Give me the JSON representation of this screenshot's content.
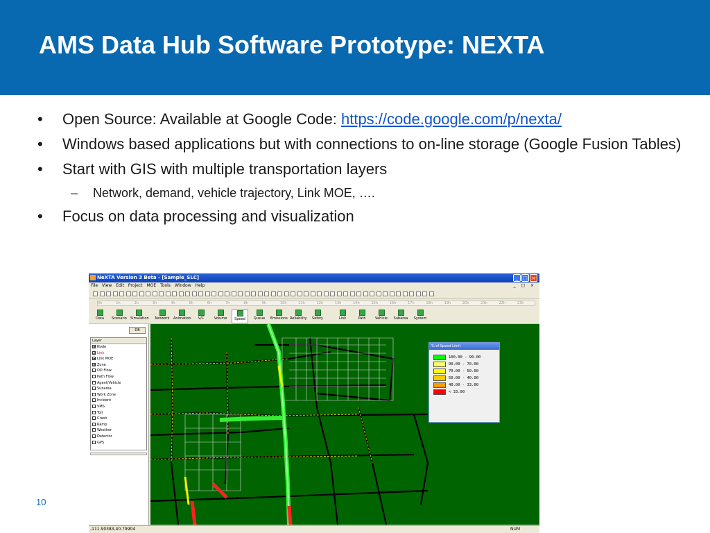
{
  "slide": {
    "title": "AMS Data Hub Software Prototype: NEXTA",
    "page_number": "10",
    "bullets": [
      {
        "text": "Open Source: Available at Google Code: ",
        "link": "https://code.google.com/p/nexta/"
      },
      {
        "text": "Windows based applications but with connections to on-line storage (Google Fusion Tables)"
      },
      {
        "text": "Start with GIS with multiple transportation layers"
      },
      {
        "text": "Network, demand, vehicle trajectory, Link MOE, ….",
        "sub": true
      },
      {
        "text": "Focus on data processing and visualization"
      }
    ],
    "bullet_glyph": "•",
    "sub_glyph": "–"
  },
  "app": {
    "window_title": "NeXTA Version 3 Beta - [Sample_SLC]",
    "window_controls": [
      "_",
      "□",
      "×"
    ],
    "menu": [
      "File",
      "View",
      "Edit",
      "Project",
      "MOE",
      "Tools",
      "Window",
      "Help"
    ],
    "mdi_controls": "_ □ ×",
    "timeline_ticks": [
      "0h",
      "1h",
      "2h",
      "3h",
      "4h",
      "5h",
      "6h",
      "7h",
      "8h",
      "9h",
      "10h",
      "11h",
      "12h",
      "13h",
      "14h",
      "15h",
      "16h",
      "17h",
      "18h",
      "19h",
      "20h",
      "21h",
      "22h",
      "23h"
    ],
    "modes": [
      {
        "label": "Data",
        "icon": "data-icon"
      },
      {
        "label": "Scenario",
        "icon": "scenario-icon"
      },
      {
        "label": "Simulation",
        "icon": "simulation-icon"
      },
      {
        "label": "Network",
        "icon": "network-icon"
      },
      {
        "label": "Animation",
        "icon": "animation-icon"
      },
      {
        "label": "V/C",
        "icon": "vc-icon"
      },
      {
        "label": "Volume",
        "icon": "volume-icon"
      },
      {
        "label": "Speed",
        "icon": "speed-icon",
        "active": true
      },
      {
        "label": "Queue",
        "icon": "queue-icon"
      },
      {
        "label": "Emissions",
        "icon": "emissions-icon"
      },
      {
        "label": "Reliability",
        "icon": "reliability-icon"
      },
      {
        "label": "Safety",
        "icon": "safety-icon"
      },
      {
        "label": "Link",
        "icon": "link-icon"
      },
      {
        "label": "Path",
        "icon": "path-icon"
      },
      {
        "label": "Vehicle",
        "icon": "vehicle-icon"
      },
      {
        "label": "Subarea",
        "icon": "subarea-icon"
      },
      {
        "label": "System",
        "icon": "system-icon"
      }
    ],
    "db_button": "DB",
    "layer_header": "Layer",
    "layers": [
      {
        "label": "Node",
        "checked": true
      },
      {
        "label": "Link",
        "checked": true,
        "highlight": true
      },
      {
        "label": "Link MOE",
        "checked": true
      },
      {
        "label": "Zone",
        "checked": true
      },
      {
        "label": "OD Flow",
        "checked": false
      },
      {
        "label": "Path Flow",
        "checked": false
      },
      {
        "label": "Agent/Vehicle",
        "checked": false
      },
      {
        "label": "Subarea",
        "checked": false
      },
      {
        "label": "Work Zone",
        "checked": false
      },
      {
        "label": "Incident",
        "checked": false
      },
      {
        "label": "VMS",
        "checked": false
      },
      {
        "label": "Toll",
        "checked": false
      },
      {
        "label": "Crash",
        "checked": false
      },
      {
        "label": "Ramp",
        "checked": false
      },
      {
        "label": "Weather",
        "checked": false
      },
      {
        "label": "Detector",
        "checked": false
      },
      {
        "label": "GPS",
        "checked": false
      }
    ],
    "legend": {
      "title": "% of Speed Limit",
      "rows": [
        {
          "label": "100.00 - 90.00",
          "color": "#00ff00"
        },
        {
          "label": "90.00 - 70.00",
          "color": "#ffff66"
        },
        {
          "label": "70.00 - 50.00",
          "color": "#ffff00"
        },
        {
          "label": "50.00 - 40.00",
          "color": "#ffcc00"
        },
        {
          "label": "40.00 - 33.00",
          "color": "#ff9900"
        },
        {
          "label": "< 33.00",
          "color": "#ff0000"
        }
      ]
    },
    "status": {
      "coordinates": "-111.90383,40.79904",
      "num": "NUM"
    },
    "colors": {
      "map_background": "#006400",
      "header": "#0969b0"
    }
  }
}
